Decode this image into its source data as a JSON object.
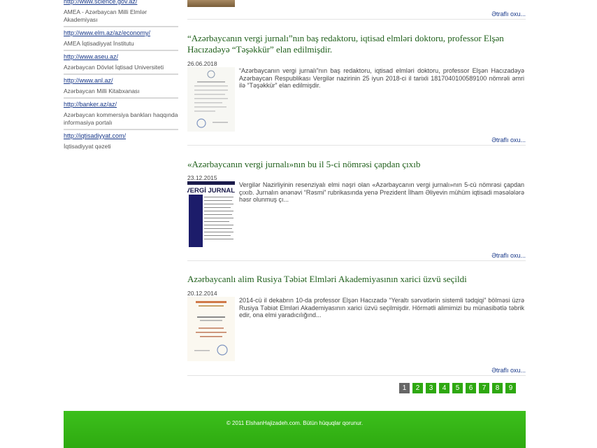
{
  "sidebar": {
    "items": [
      {
        "link": "http://www.science.gov.az/",
        "desc": "AMEA - Azərbaycan Milli Elmlər Akademiyası"
      },
      {
        "link": "http://www.elm.az/az/economy/",
        "desc": "AMEA İqtisadiyyat İnstitutu"
      },
      {
        "link": "http://www.aseu.az/",
        "desc": "Azərbaycan Dövlət İqtisad Universiteti"
      },
      {
        "link": "http://www.anl.az/",
        "desc": "Azərbaycan Milli Kitabxanası"
      },
      {
        "link": "http://banker.az/az/",
        "desc": "Azərbaycan kommersiya bankları haqqında informasiya portalı"
      },
      {
        "link": "http://iqtisadiyyat.com/",
        "desc": "İqtisadiyyat qəzeti"
      }
    ]
  },
  "read_more": "Ətraflı oxu...",
  "articles": [
    {
      "title": "“Azərbaycanın vergi jurnalı”nın baş redaktoru, iqtisad elmləri doktoru, professor Elşən Hacızadəyə “Təşəkkür” elan edilmişdir.",
      "date": "26.06.2018",
      "excerpt": "“Azərbaycanın vergi jurnalı”nın baş redaktoru, iqtisad elmləri doktoru, professor Elşən Hacızadəyə Azərbaycan Respublikası Vergilər nazirinin 25 iyun 2018-ci il tarixli 1817040100589100 nömrəli əmri ilə “Təşəkkür” elan edilmişdir."
    },
    {
      "title": "«Azərbaycanın vergi jurnalı»nın bu il 5-ci nömrəsi çapdan çıxıb",
      "date": "23.12.2015",
      "excerpt": "Vergilər Nazirliyinin resenziyalı elmi nəşri olan «Azərbaycanın vergi jurnalı»nın 5-cü nömrəsi çapdan çıxıb. Jurnalın ənənəvi “Rəsmi” rubrikasında yenə Prezident İlham Əliyevin mühüm iqtisadi məsələlərə həsr olunmuş çı...",
      "cover_text": "VERGİ JURNALI"
    },
    {
      "title": "Azərbaycanlı alim Rusiya Təbiət Elmləri Akademiyasının xarici üzvü seçildi",
      "date": "20.12.2014",
      "excerpt": "2014-cü il dekabrın 10-da professor Elşən Hacızadə “Yeraltı sərvətlərin sistemli tədqiqi” bölməsi üzrə Rusiya Təbiət Elmləri Akademiyasının xarici üzvü seçilmişdir. Hörmətli alimimizi bu münasibətlə təbrik edir, ona elmi yaradıcılığınd..."
    }
  ],
  "pagination": {
    "pages": [
      "1",
      "2",
      "3",
      "4",
      "5",
      "6",
      "7",
      "8",
      "9"
    ],
    "current": "1",
    "active_color": "#666666",
    "color": "#2ea810"
  },
  "footer": {
    "copyright": "© 2011 ElshanHajizadeh.com. Bütün hüquqlar qorunur."
  },
  "colors": {
    "accent_green": "#2eaa10",
    "title_green": "#1f5f1a",
    "link_blue": "#1a3a8a"
  }
}
